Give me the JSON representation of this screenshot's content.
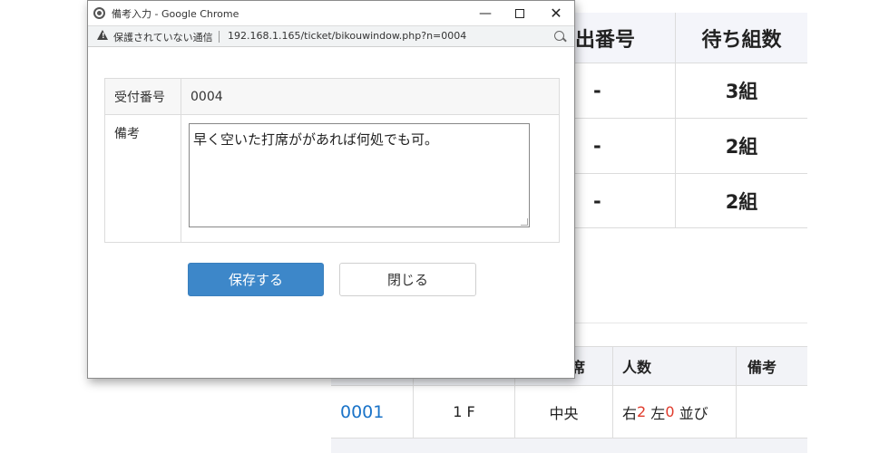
{
  "background": {
    "top_table": {
      "headers": [
        "出番号",
        "待ち組数"
      ],
      "rows": [
        {
          "number": "-",
          "wait": "3組"
        },
        {
          "number": "-",
          "wait": "2組"
        },
        {
          "number": "-",
          "wait": "2組"
        }
      ]
    },
    "bottom_table": {
      "headers": {
        "seat": "席",
        "people": "人数",
        "note": "備考"
      },
      "row": {
        "ticket": "0001",
        "floor": "1 F",
        "position": "中央",
        "people_right_label": "右",
        "people_right": "2",
        "people_left_label": "左",
        "people_left": "0",
        "people_suffix": "並び",
        "note": ""
      }
    }
  },
  "popup": {
    "window_title": "備考入力 - Google Chrome",
    "insecure_label": "保護されていない通信",
    "url": "192.168.1.165/ticket/bikouwindow.php?n=0004",
    "form": {
      "ticket_label": "受付番号",
      "ticket_value": "0004",
      "note_label": "備考",
      "note_value": "早く空いた打席ががあれば何処でも可。"
    },
    "buttons": {
      "save": "保存する",
      "close": "閉じる"
    },
    "window_controls": {
      "minimize": "—",
      "close": "✕"
    }
  },
  "colors": {
    "primary_button": "#3d87c9",
    "link": "#1a73c8",
    "highlight": "#e03a2b"
  }
}
